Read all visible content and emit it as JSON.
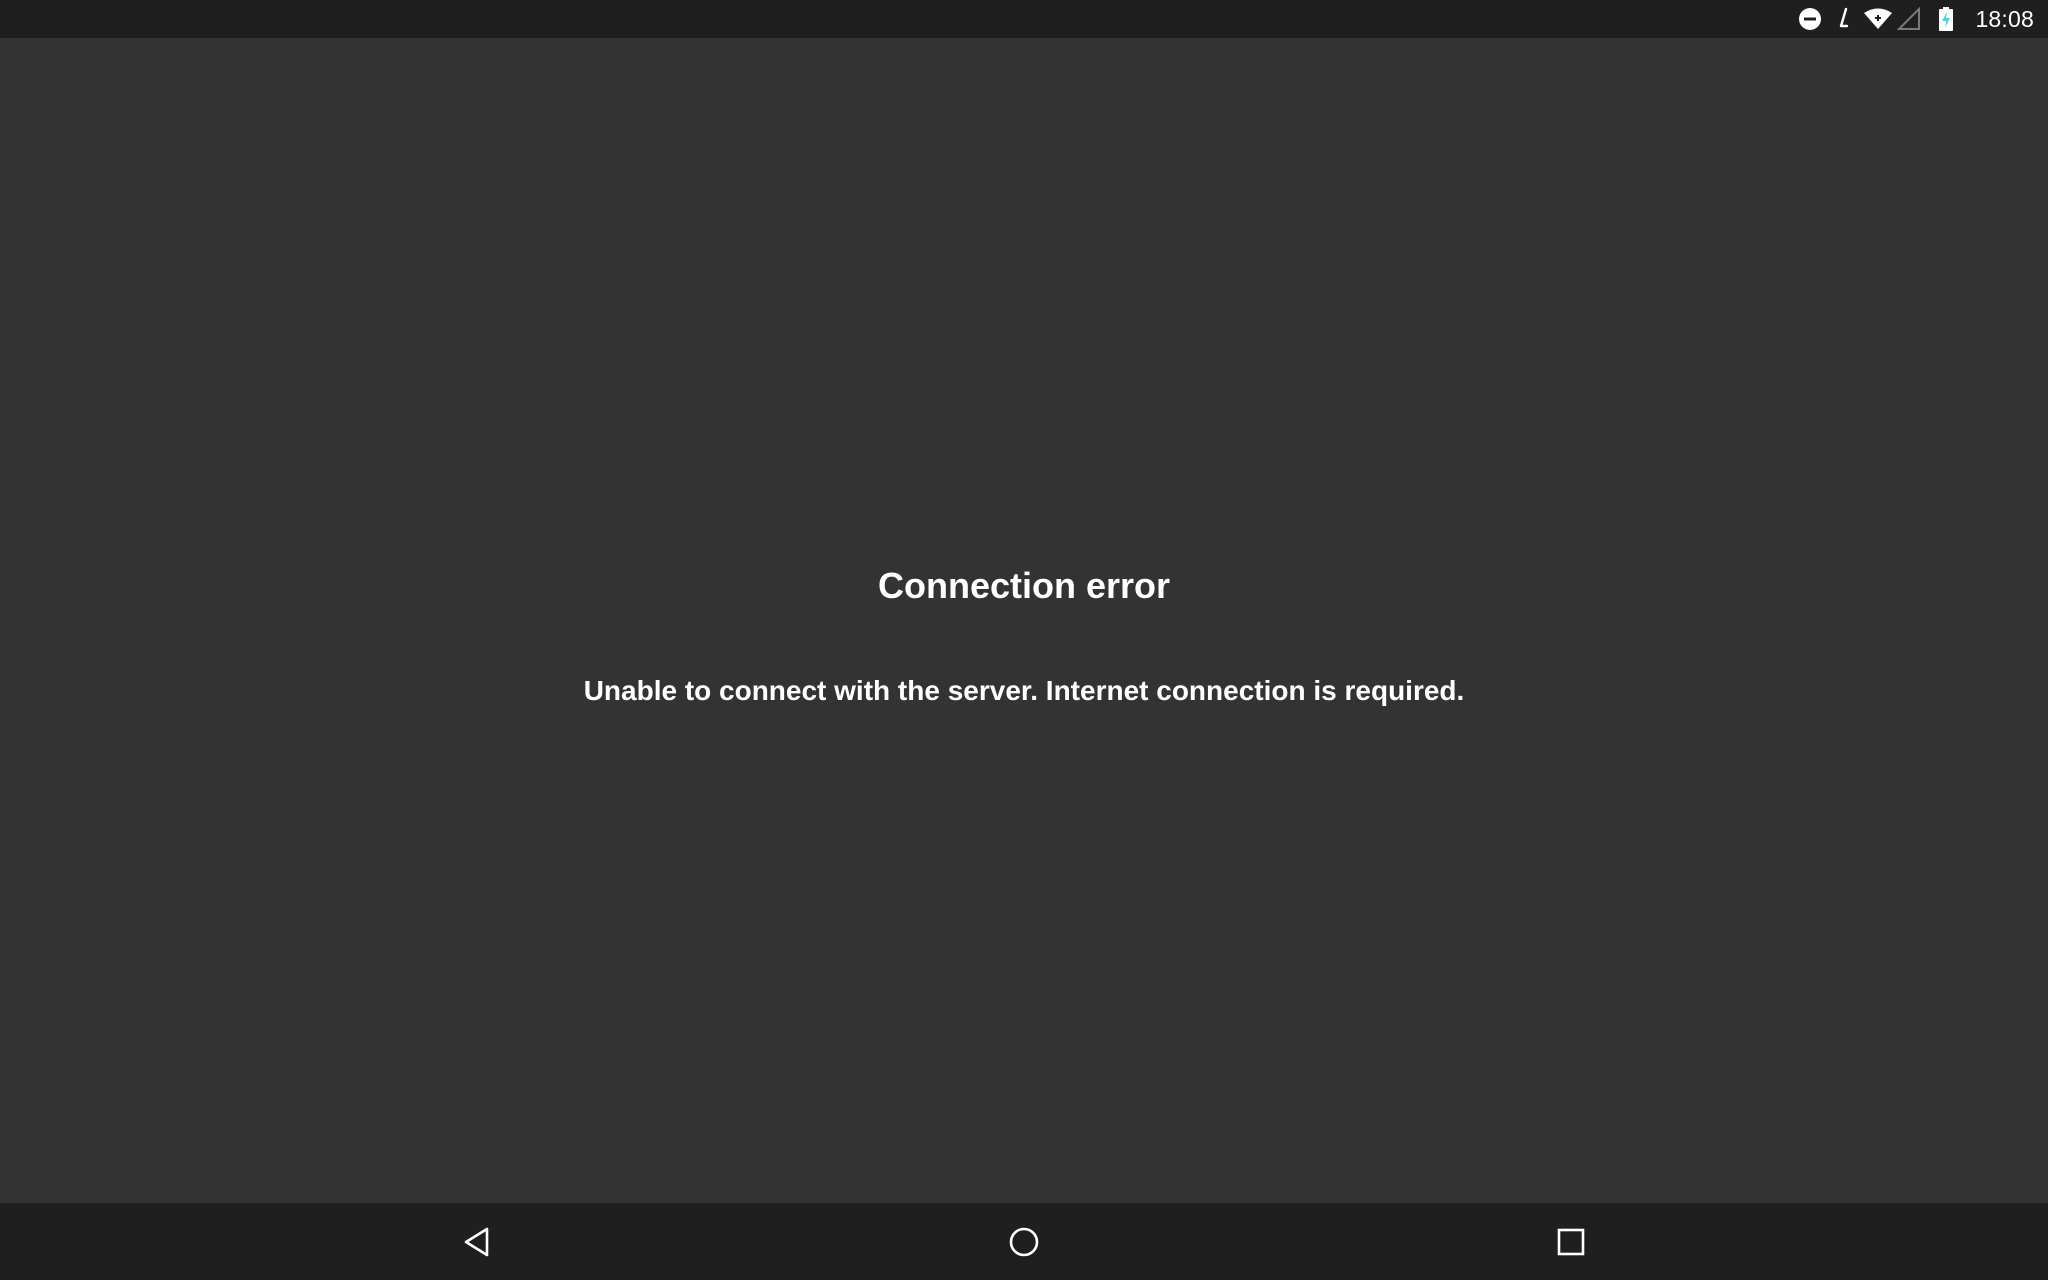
{
  "status_bar": {
    "time": "18:08",
    "icons": [
      "do-not-disturb-icon",
      "sync-icon",
      "wifi-icon",
      "cellular-signal-icon",
      "battery-charging-icon"
    ]
  },
  "error": {
    "title": "Connection error",
    "message": "Unable to connect with the server. Internet connection is required."
  },
  "nav_bar": {
    "buttons": [
      "back-icon",
      "home-icon",
      "recents-icon"
    ]
  },
  "colors": {
    "background": "#333333",
    "bars": "#1f1f1f",
    "text": "#ffffff"
  }
}
